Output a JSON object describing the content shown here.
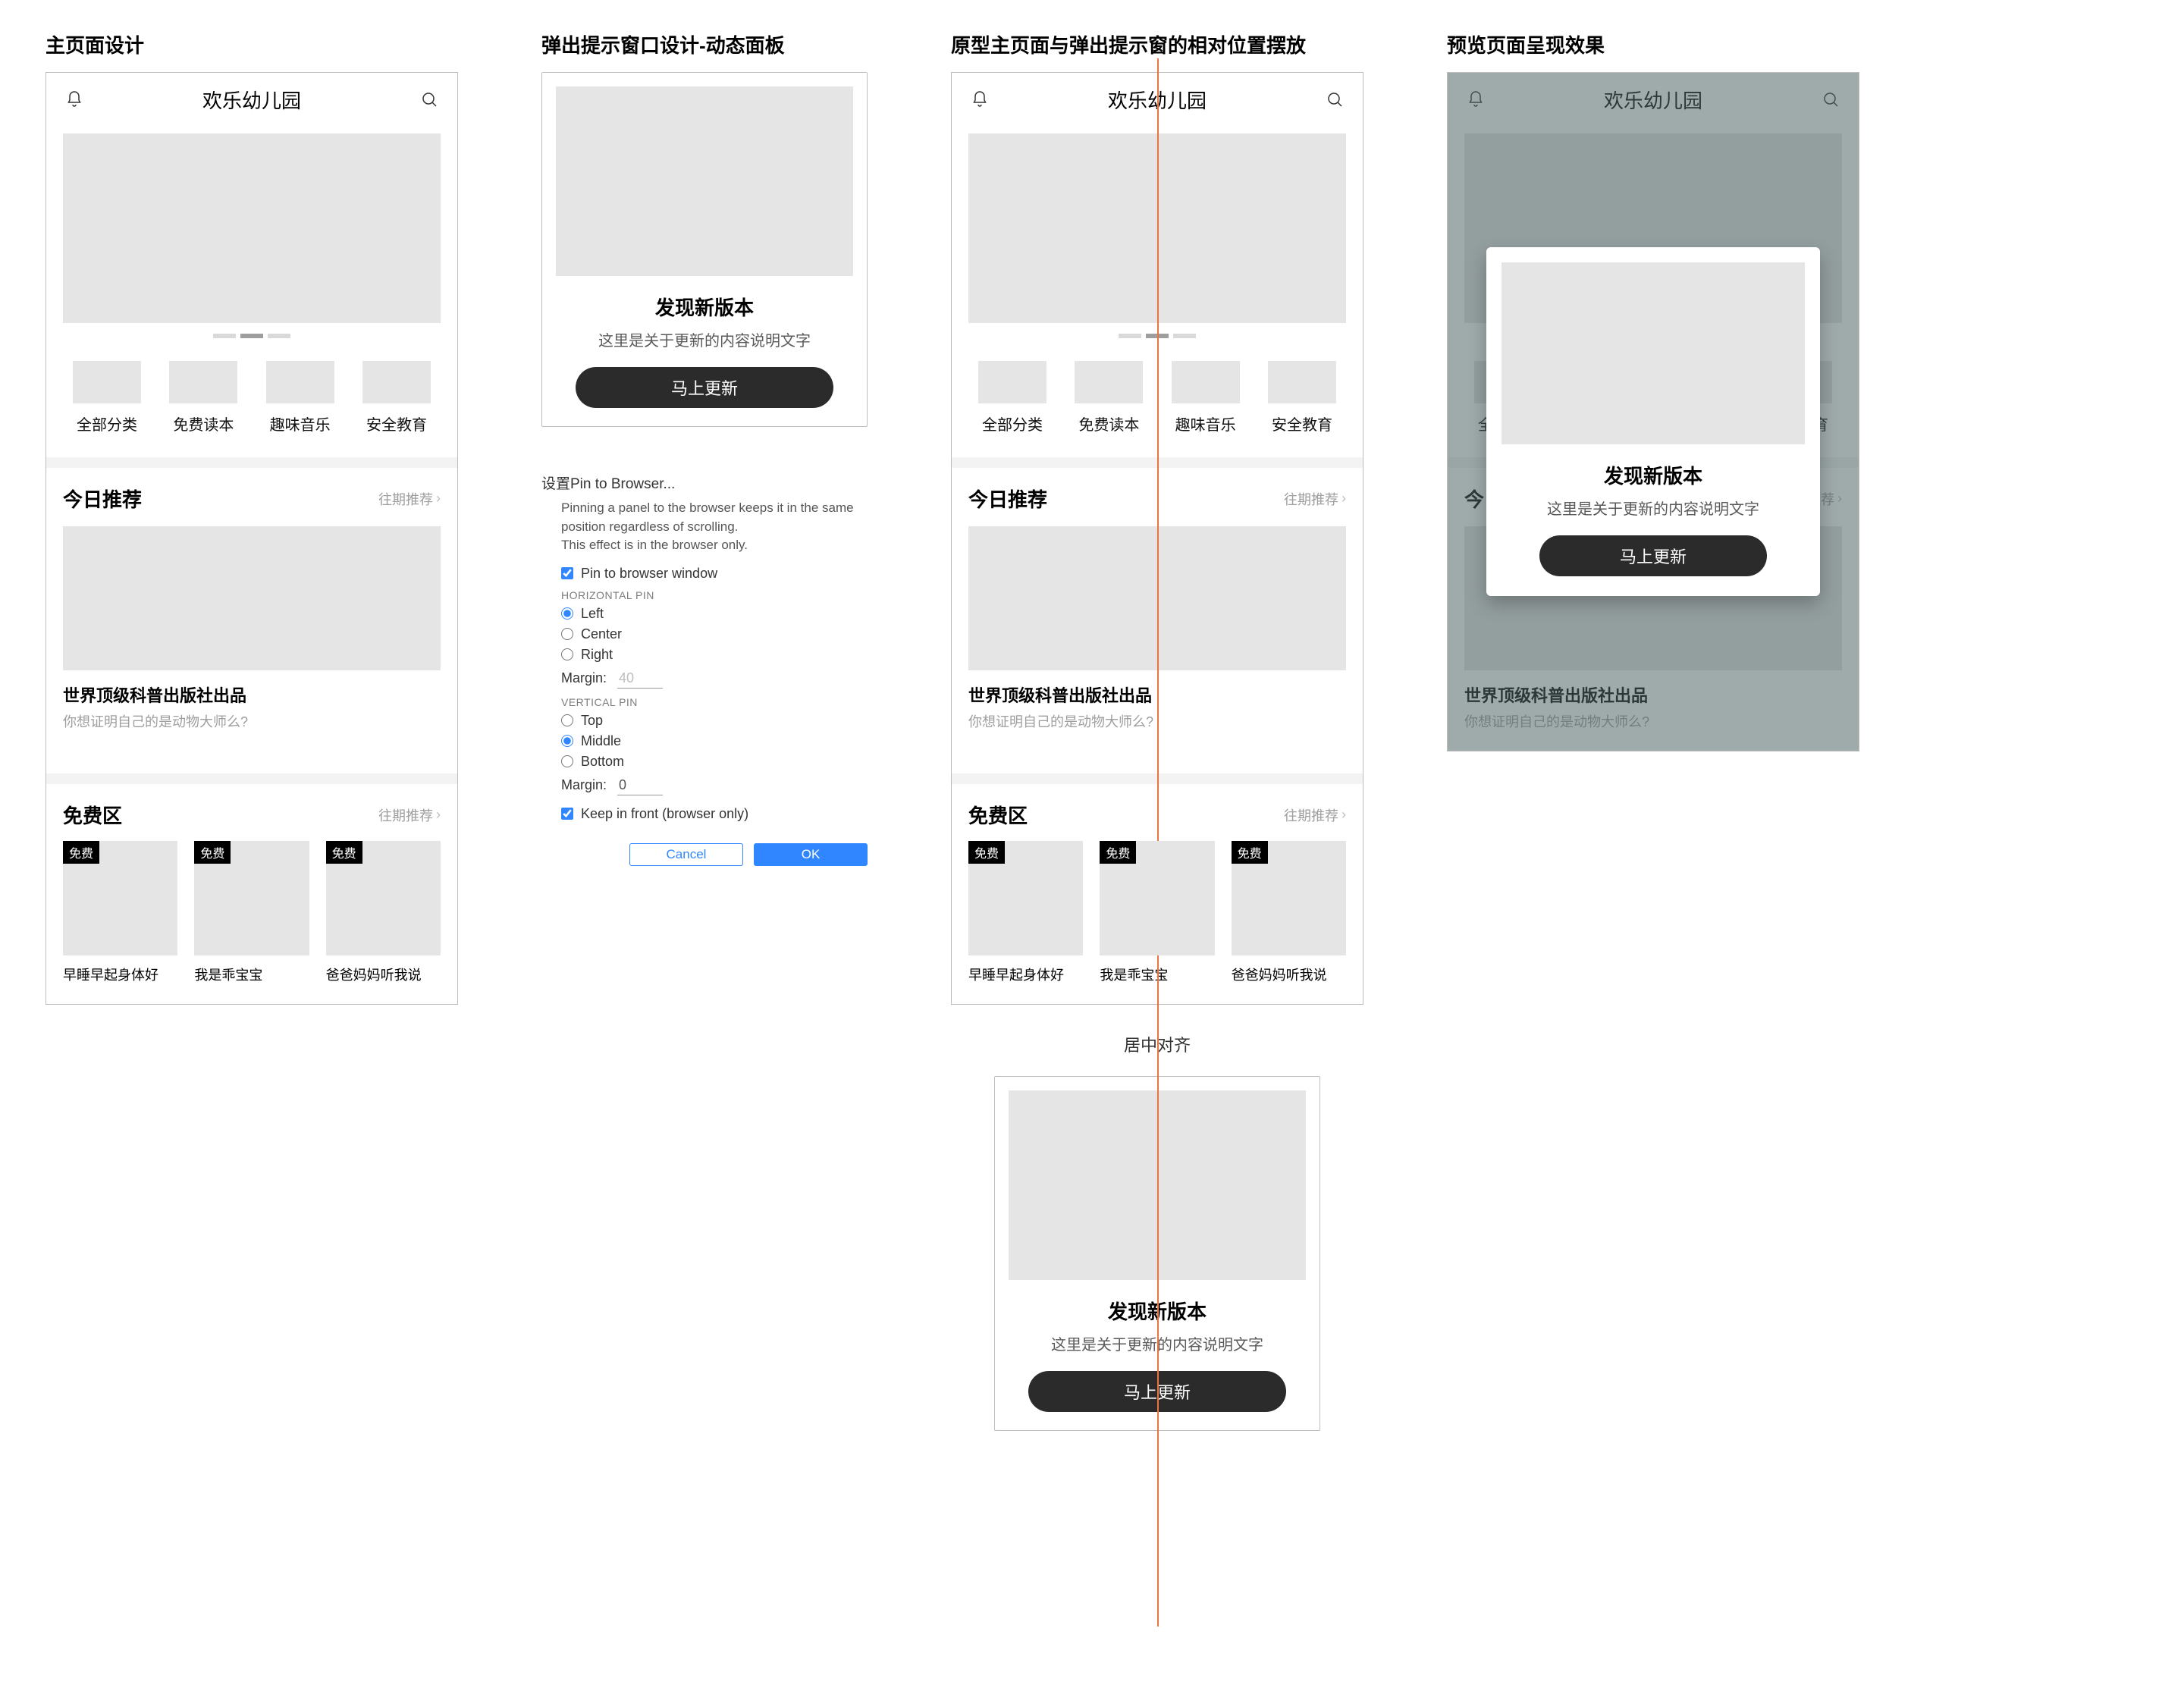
{
  "columns": {
    "c1": "主页面设计",
    "c2": "弹出提示窗口设计-动态面板",
    "c3": "原型主页面与弹出提示窗的相对位置摆放",
    "c4": "预览页面呈现效果"
  },
  "phone": {
    "title": "欢乐幼儿园",
    "categories": [
      {
        "label": "全部分类"
      },
      {
        "label": "免费读本"
      },
      {
        "label": "趣味音乐"
      },
      {
        "label": "安全教育"
      }
    ],
    "recommend": {
      "section_title": "今日推荐",
      "more": "往期推荐",
      "item_title": "世界顶级科普出版社出品",
      "item_sub": "你想证明自己的是动物大师么?"
    },
    "free": {
      "section_title": "免费区",
      "more": "往期推荐",
      "badge": "免费",
      "items": [
        {
          "label": "早睡早起身体好"
        },
        {
          "label": "我是乖宝宝"
        },
        {
          "label": "爸爸妈妈听我说"
        }
      ]
    }
  },
  "popup": {
    "title": "发现新版本",
    "desc": "这里是关于更新的内容说明文字",
    "button": "马上更新"
  },
  "pin": {
    "header": "设置Pin to Browser...",
    "note1": "Pinning a panel to the browser keeps it in the same position regardless of scrolling.",
    "note2": "This effect is in the browser only.",
    "checkbox_pin": "Pin to browser window",
    "group_h": "HORIZONTAL PIN",
    "h_left": "Left",
    "h_center": "Center",
    "h_right": "Right",
    "margin_label": "Margin:",
    "margin_h_value": "40",
    "group_v": "VERTICAL PIN",
    "v_top": "Top",
    "v_middle": "Middle",
    "v_bottom": "Bottom",
    "margin_v_value": "0",
    "keep_front": "Keep in front (browser only)",
    "cancel": "Cancel",
    "ok": "OK",
    "h_selected": "Left",
    "v_selected": "Middle"
  },
  "center_caption": "居中对齐"
}
